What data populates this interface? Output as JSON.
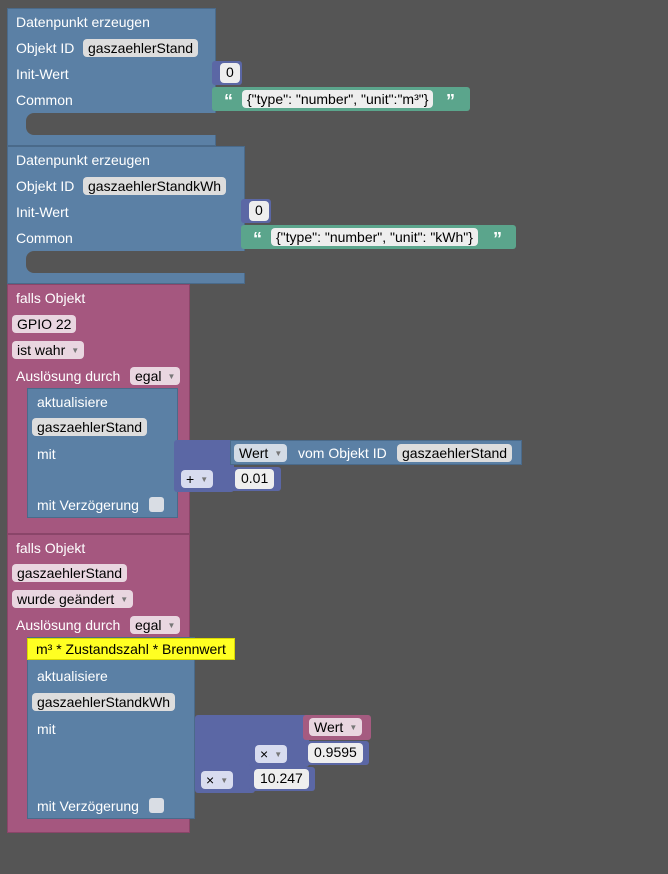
{
  "block1": {
    "title": "Datenpunkt erzeugen",
    "objekt_id_label": "Objekt ID",
    "objekt_id_value": "gaszaehlerStand",
    "init_label": "Init-Wert",
    "init_value": "0",
    "common_label": "Common",
    "common_value": "{\"type\": \"number\", \"unit\":\"m³\"}"
  },
  "block2": {
    "title": "Datenpunkt erzeugen",
    "objekt_id_label": "Objekt ID",
    "objekt_id_value": "gaszaehlerStandkWh",
    "init_label": "Init-Wert",
    "init_value": "0",
    "common_label": "Common",
    "common_value": "{\"type\": \"number\", \"unit\": \"kWh\"}"
  },
  "trigger1": {
    "title": "falls Objekt",
    "object": "GPIO 22",
    "condition": "ist wahr",
    "ausloesung_label": "Auslösung durch",
    "ausloesung_value": "egal",
    "update": {
      "title": "aktualisiere",
      "target": "gaszaehlerStand",
      "mit_label": "mit",
      "delay_label": "mit Verzögerung"
    },
    "expr": {
      "wert_dropdown": "Wert",
      "vom_label": "vom Objekt ID",
      "vom_value": "gaszaehlerStand",
      "operator": "+",
      "operand": "0.01"
    }
  },
  "trigger2": {
    "title": "falls Objekt",
    "object": "gaszaehlerStand",
    "condition": "wurde geändert",
    "ausloesung_label": "Auslösung durch",
    "ausloesung_value": "egal",
    "comment": "m³ * Zustandszahl * Brennwert",
    "update": {
      "title": "aktualisiere",
      "target": "gaszaehlerStandkWh",
      "mit_label": "mit",
      "delay_label": "mit Verzögerung"
    },
    "expr": {
      "wert_dropdown": "Wert",
      "operator_inner": "×",
      "operand_inner": "0.9595",
      "operator_outer": "×",
      "operand_outer": "10.247"
    }
  },
  "dropdown_arrow": "▼",
  "quote_open": "“",
  "quote_close": "”"
}
